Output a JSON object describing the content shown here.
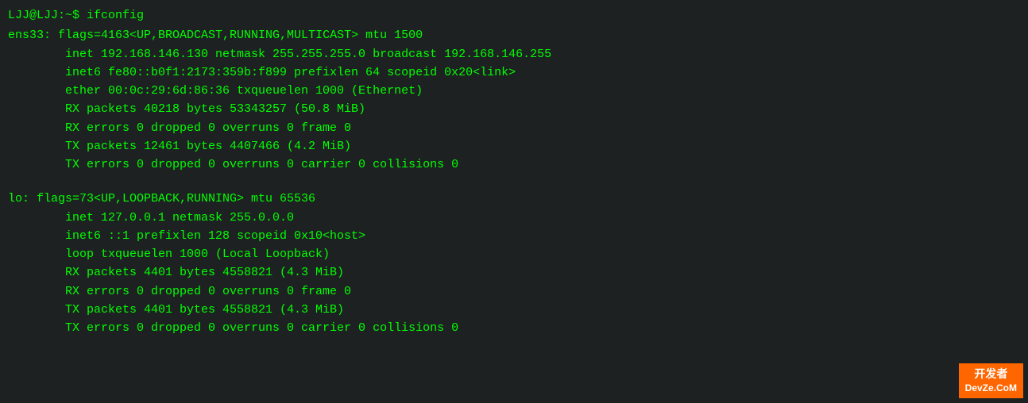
{
  "terminal": {
    "prompt": "LJJ@LJJ:~$ ifconfig",
    "ens33": {
      "header": "ens33: flags=4163<UP,BROADCAST,RUNNING,MULTICAST>  mtu 1500",
      "lines": [
        "inet 192.168.146.130  netmask 255.255.255.0  broadcast 192.168.146.255",
        "inet6 fe80::b0f1:2173:359b:f899  prefixlen 64  scopeid 0x20<link>",
        "ether 00:0c:29:6d:86:36  txqueuelen 1000  (Ethernet)",
        "RX packets 40218  bytes 53343257 (50.8 MiB)",
        "RX errors 0  dropped 0  overruns 0  frame 0",
        "TX packets 12461  bytes 4407466 (4.2 MiB)",
        "TX errors 0  dropped 0 overruns 0  carrier 0  collisions 0"
      ]
    },
    "lo": {
      "header": "lo: flags=73<UP,LOOPBACK,RUNNING>  mtu 65536",
      "lines": [
        "inet 127.0.0.1  netmask 255.0.0.0",
        "inet6 ::1  prefixlen 128  scopeid 0x10<host>",
        "loop  txqueuelen 1000  (Local Loopback)",
        "RX packets 4401  bytes 4558821 (4.3 MiB)",
        "RX errors 0  dropped 0  overruns 0  frame 0",
        "TX packets 4401  bytes 4558821 (4.3 MiB)",
        "TX errors 0  dropped 0 overruns 0  carrier 0  collisions 0"
      ]
    }
  },
  "watermark": {
    "cn": "开发者",
    "en": "DevZe.CoM"
  }
}
